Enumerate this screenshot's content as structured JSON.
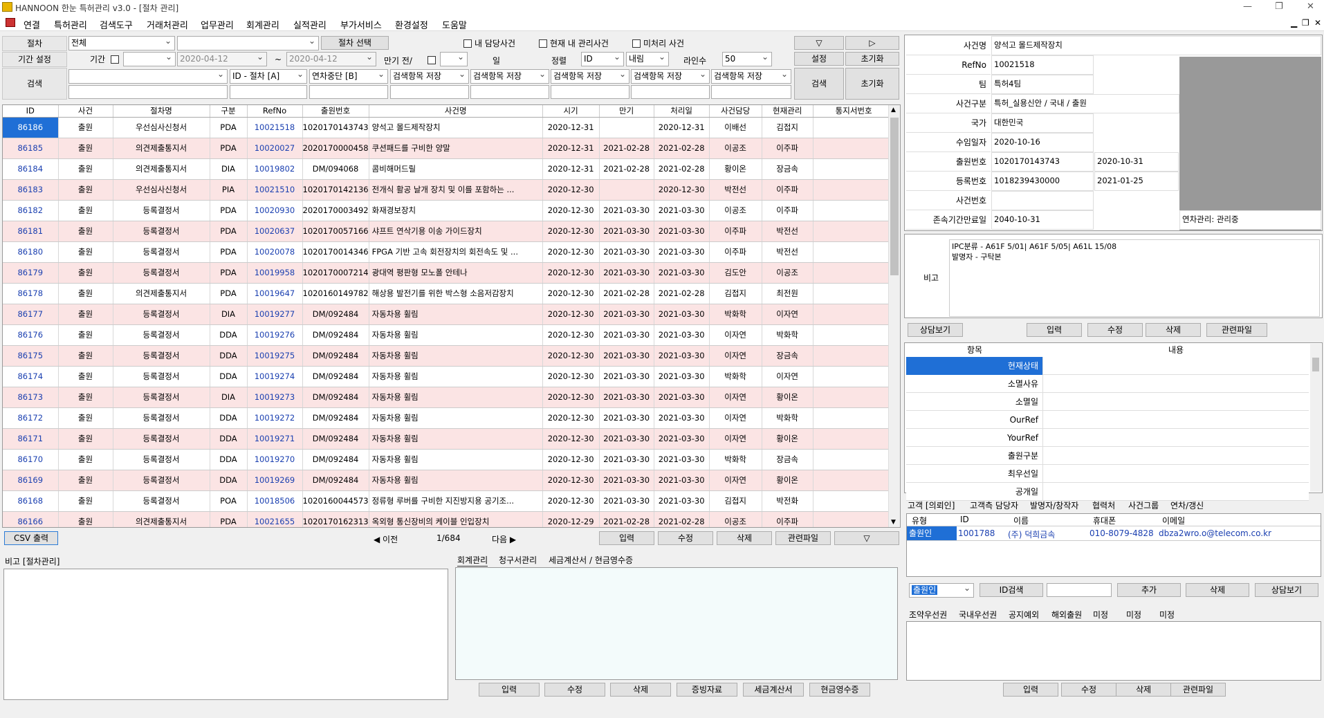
{
  "window": {
    "title": "HANNOON 한눈 특허관리 v3.0 - [절차 관리]"
  },
  "menu": [
    "연결",
    "특허관리",
    "검색도구",
    "거래처관리",
    "업무관리",
    "회계관리",
    "실적관리",
    "부가서비스",
    "환경설정",
    "도움말"
  ],
  "filters": {
    "procedure_label": "절차",
    "procedure_value": "전체",
    "select_procedure_btn": "절차 선택",
    "my_cases": "내 담당사건",
    "current_cases": "현재 내 관리사건",
    "unprocessed": "미처리 사건",
    "down_btn": "▽",
    "right_btn": "▷",
    "period_label": "기간 설정",
    "period": "기간",
    "date_from": "2020-04-12",
    "tilde": "~",
    "date_to": "2020-04-12",
    "due_before": "만기 전/",
    "day": "일",
    "sort_label": "정렬",
    "sort_value": "ID",
    "order_value": "내림",
    "lines_label": "라인수",
    "lines_value": "50",
    "settings_btn": "설정",
    "reset_btn": "초기화",
    "search_label": "검색",
    "search_fields": [
      "ID - 절차 [A]",
      "연차중단 [B]",
      "검색항목 저장",
      "검색항목 저장",
      "검색항목 저장",
      "검색항목 저장",
      "검색항목 저장"
    ],
    "search_btn": "검색",
    "reset_btn2": "초기화"
  },
  "grid": {
    "columns": [
      "ID",
      "사건",
      "절차명",
      "구분",
      "RefNo",
      "출원번호",
      "사건명",
      "시기",
      "만기",
      "처리일",
      "사건담당",
      "현재관리",
      "통지서번호"
    ],
    "rows": [
      [
        "86186",
        "출원",
        "우선심사신청서",
        "PDA",
        "10021518",
        "1020170143743",
        "양석고 몰드제작장치",
        "2020-12-31",
        "",
        "2020-12-31",
        "이배선",
        "김접지",
        ""
      ],
      [
        "86185",
        "출원",
        "의견제출통지서",
        "PDA",
        "10020027",
        "2020170000458",
        "쿠션패드를 구비한 양말",
        "2020-12-31",
        "2021-02-28",
        "2021-02-28",
        "이공조",
        "이주파",
        ""
      ],
      [
        "86184",
        "출원",
        "의견제출통지서",
        "DIA",
        "10019802",
        "DM/094068",
        "콤비해머드릴",
        "2020-12-31",
        "2021-02-28",
        "2021-02-28",
        "황이온",
        "장금속",
        ""
      ],
      [
        "86183",
        "출원",
        "우선심사신청서",
        "PIA",
        "10021510",
        "1020170142136",
        "전개식 활공 날개 장치 및 이를 포함하는 ...",
        "2020-12-30",
        "",
        "2020-12-30",
        "박전선",
        "이주파",
        ""
      ],
      [
        "86182",
        "출원",
        "등록결정서",
        "PDA",
        "10020930",
        "2020170003492",
        "화재경보장치",
        "2020-12-30",
        "2021-03-30",
        "2021-03-30",
        "이공조",
        "이주파",
        ""
      ],
      [
        "86181",
        "출원",
        "등록결정서",
        "PDA",
        "10020637",
        "1020170057166",
        "샤프트 연삭기용 이송 가이드장치",
        "2020-12-30",
        "2021-03-30",
        "2021-03-30",
        "이주파",
        "박전선",
        ""
      ],
      [
        "86180",
        "출원",
        "등록결정서",
        "PDA",
        "10020078",
        "1020170014346",
        "FPGA 기반 고속 회전장치의 회전속도 및 ...",
        "2020-12-30",
        "2021-03-30",
        "2021-03-30",
        "이주파",
        "박전선",
        ""
      ],
      [
        "86179",
        "출원",
        "등록결정서",
        "PDA",
        "10019958",
        "1020170007214",
        "광대역 평판형 모노폴 안테나",
        "2020-12-30",
        "2021-03-30",
        "2021-03-30",
        "김도안",
        "이공조",
        ""
      ],
      [
        "86178",
        "출원",
        "의견제출통지서",
        "PDA",
        "10019647",
        "1020160149782",
        "해상용 발전기를 위한 박스형 소음저감장치",
        "2020-12-30",
        "2021-02-28",
        "2021-02-28",
        "김접지",
        "최전원",
        ""
      ],
      [
        "86177",
        "출원",
        "등록결정서",
        "DIA",
        "10019277",
        "DM/092484",
        "자동차용 휠림",
        "2020-12-30",
        "2021-03-30",
        "2021-03-30",
        "박화학",
        "이자연",
        ""
      ],
      [
        "86176",
        "출원",
        "등록결정서",
        "DDA",
        "10019276",
        "DM/092484",
        "자동차용 휠림",
        "2020-12-30",
        "2021-03-30",
        "2021-03-30",
        "이자연",
        "박화학",
        ""
      ],
      [
        "86175",
        "출원",
        "등록결정서",
        "DDA",
        "10019275",
        "DM/092484",
        "자동차용 휠림",
        "2020-12-30",
        "2021-03-30",
        "2021-03-30",
        "이자연",
        "장금속",
        ""
      ],
      [
        "86174",
        "출원",
        "등록결정서",
        "DDA",
        "10019274",
        "DM/092484",
        "자동차용 휠림",
        "2020-12-30",
        "2021-03-30",
        "2021-03-30",
        "박화학",
        "이자연",
        ""
      ],
      [
        "86173",
        "출원",
        "등록결정서",
        "DIA",
        "10019273",
        "DM/092484",
        "자동차용 휠림",
        "2020-12-30",
        "2021-03-30",
        "2021-03-30",
        "이자연",
        "황이온",
        ""
      ],
      [
        "86172",
        "출원",
        "등록결정서",
        "DDA",
        "10019272",
        "DM/092484",
        "자동차용 휠림",
        "2020-12-30",
        "2021-03-30",
        "2021-03-30",
        "이자연",
        "박화학",
        ""
      ],
      [
        "86171",
        "출원",
        "등록결정서",
        "DDA",
        "10019271",
        "DM/092484",
        "자동차용 휠림",
        "2020-12-30",
        "2021-03-30",
        "2021-03-30",
        "이자연",
        "황이온",
        ""
      ],
      [
        "86170",
        "출원",
        "등록결정서",
        "DDA",
        "10019270",
        "DM/092484",
        "자동차용 휠림",
        "2020-12-30",
        "2021-03-30",
        "2021-03-30",
        "박화학",
        "장금속",
        ""
      ],
      [
        "86169",
        "출원",
        "등록결정서",
        "DDA",
        "10019269",
        "DM/092484",
        "자동차용 휠림",
        "2020-12-30",
        "2021-03-30",
        "2021-03-30",
        "이자연",
        "황이온",
        ""
      ],
      [
        "86168",
        "출원",
        "등록결정서",
        "POA",
        "10018506",
        "1020160044573",
        "정류형 루버를 구비한 지진방지용 공기조...",
        "2020-12-30",
        "2021-03-30",
        "2021-03-30",
        "김접지",
        "박전화",
        ""
      ],
      [
        "86166",
        "출원",
        "의견제출통지서",
        "PDA",
        "10021655",
        "1020170162313",
        "옥외형 통신장비의 케이블 인입장치",
        "2020-12-29",
        "2021-02-28",
        "2021-02-28",
        "이공조",
        "이주파",
        ""
      ]
    ]
  },
  "pager": {
    "csv_btn": "CSV 출력",
    "prev": "◀ 이전",
    "page": "1/684",
    "next": "다음 ▶",
    "input": "입력",
    "edit": "수정",
    "delete": "삭제",
    "files": "관련파일",
    "down": "▽"
  },
  "bottom": {
    "memo_label": "비고 [절차관리]",
    "tabs": [
      "회계관리",
      "청구서관리",
      "세금계산서 / 현금영수증"
    ],
    "buttons": [
      "입력",
      "수정",
      "삭제",
      "증빙자료",
      "세금계산서",
      "현금영수증"
    ]
  },
  "detail": {
    "labels": [
      "사건명",
      "RefNo",
      "팀",
      "사건구분",
      "국가",
      "수임일자",
      "출원번호",
      "등록번호",
      "사건번호",
      "존속기간만료일"
    ],
    "values": [
      "양석고 몰드제작장치",
      "10021518",
      "특허4팀",
      "특허_실용신안 / 국내 / 출원",
      "대한민국",
      "2020-10-16",
      "1020170143743",
      "1018239430000",
      "",
      "2040-10-31"
    ],
    "filing_date": "2020-10-31",
    "reg_date": "2021-01-25",
    "annuity": "연차관리: 관리중",
    "memo_label": "비고",
    "memo_lines": [
      "IPC분류 - A61F 5/01| A61F 5/05| A61L 15/08",
      "발명자 - 구탁본"
    ],
    "buttons": [
      "상담보기",
      "입력",
      "수정",
      "삭제",
      "관련파일"
    ]
  },
  "items": {
    "header_key": "항목",
    "header_val": "내용",
    "rows": [
      "현재상태",
      "소멸사유",
      "소멸일",
      "OurRef",
      "YourRef",
      "출원구분",
      "최우선일",
      "공개일"
    ]
  },
  "client": {
    "tabs": [
      "고객 [의뢰인]",
      "고객측 담당자",
      "발명자/창작자",
      "협력처",
      "사건그룹",
      "연차/갱신"
    ],
    "columns": [
      "유형",
      "ID",
      "이름",
      "휴대폰",
      "이메일"
    ],
    "row": [
      "출원인",
      "1001788",
      "(주) 덕희금속",
      "010-8079-4828",
      "dbza2wro.o@telecom.co.kr"
    ],
    "type_select": "출원인",
    "buttons": [
      "ID검색",
      "추가",
      "삭제",
      "상담보기"
    ]
  },
  "priority": {
    "tabs": [
      "조약우선권",
      "국내우선권",
      "공지예외",
      "해외출원",
      "미정",
      "미정",
      "미정"
    ],
    "buttons": [
      "입력",
      "수정",
      "삭제",
      "관련파일"
    ]
  }
}
